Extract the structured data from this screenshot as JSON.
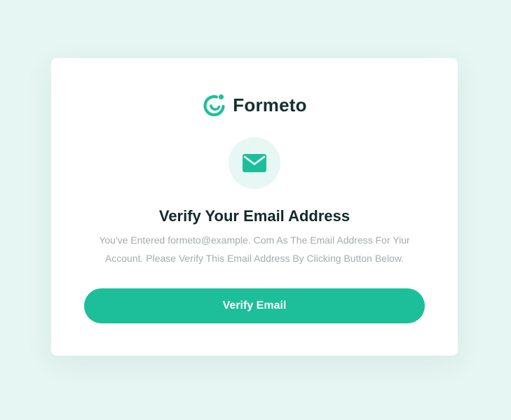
{
  "brand": {
    "name": "Formeto",
    "logo_icon": "formeto-logo-icon",
    "accent_color": "#1dbf9a",
    "dark_color": "#13312e"
  },
  "badge": {
    "icon": "envelope-icon"
  },
  "content": {
    "title": "Verify Your Email Address",
    "line1": "You've Entered formeto@example. Com As The Email Address For Yiur",
    "line2": "Account. Please Verify This Email Address By Clicking Button Below."
  },
  "actions": {
    "verify_label": "Verify Email"
  }
}
